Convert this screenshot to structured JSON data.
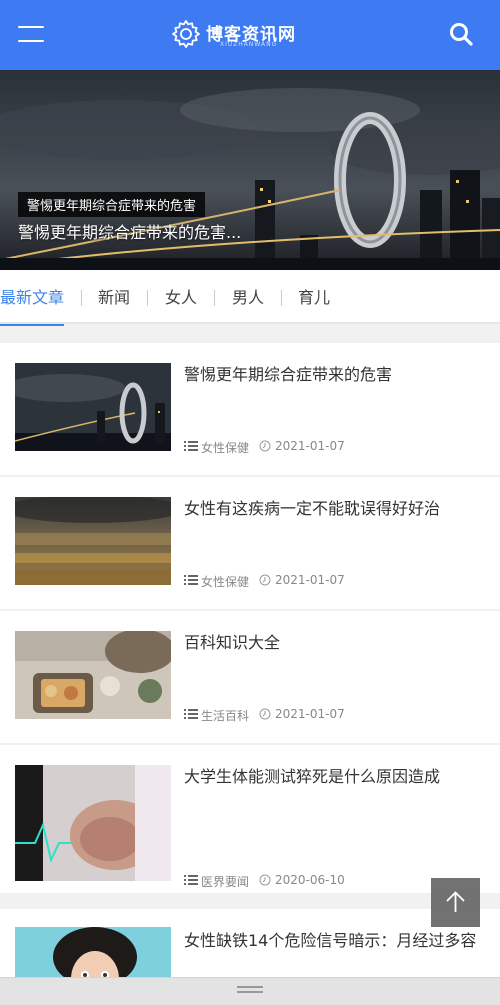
{
  "header": {
    "site_name": "博客资讯网",
    "site_sub": "XIUZHANWANG",
    "menu_icon": "hamburger-menu-icon",
    "search_icon": "search-icon",
    "brand_color": "#3e7bf2"
  },
  "banner": {
    "tag": "警惕更年期综合症带来的危害",
    "caption": "警惕更年期综合症带来的危害..."
  },
  "tabs": [
    {
      "label": "最新文章",
      "active": true
    },
    {
      "label": "新闻"
    },
    {
      "label": "女人"
    },
    {
      "label": "男人"
    },
    {
      "label": "育儿"
    }
  ],
  "articles": [
    {
      "title": "警惕更年期综合症带来的危害",
      "category": "女性保健",
      "date": "2021-01-07"
    },
    {
      "title": "女性有这疾病一定不能耽误得好好治",
      "category": "女性保健",
      "date": "2021-01-07"
    },
    {
      "title": "百科知识大全",
      "category": "生活百科",
      "date": "2021-01-07"
    },
    {
      "title": "大学生体能测试猝死是什么原因造成",
      "category": "医界要闻",
      "date": "2020-06-10"
    },
    {
      "title": "女性缺铁14个危险信号暗示：月经过多容",
      "category": "",
      "date": ""
    }
  ],
  "accent_color": "#3e84e8"
}
